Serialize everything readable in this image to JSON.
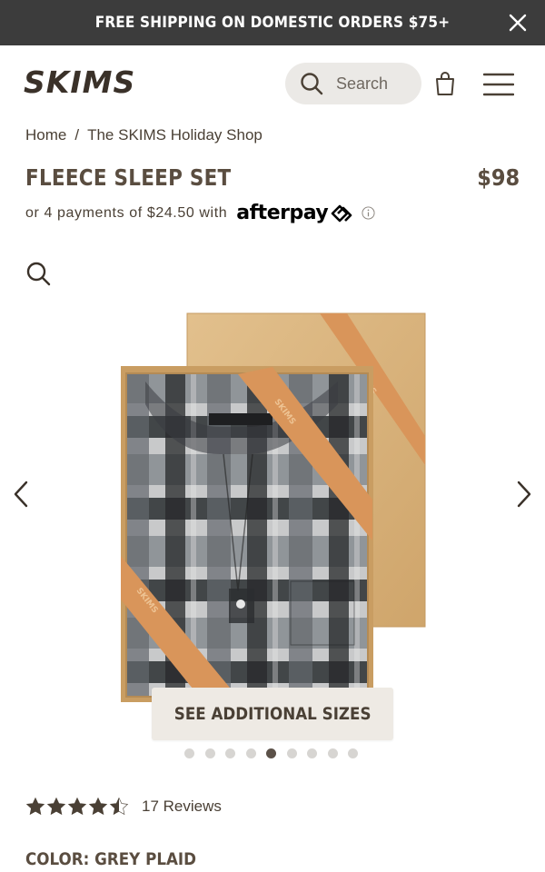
{
  "promo": {
    "text": "FREE SHIPPING ON DOMESTIC ORDERS $75+",
    "close_icon": "close-icon"
  },
  "header": {
    "logo_text": "SKIMS",
    "search_placeholder": "Search",
    "icons": [
      "search-icon",
      "shopping-bag-icon",
      "hamburger-menu-icon"
    ]
  },
  "breadcrumb": {
    "items": [
      "Home",
      "The SKIMS Holiday Shop"
    ],
    "separator": "/"
  },
  "product": {
    "title": "FLEECE SLEEP SET",
    "price": "$98",
    "installment_text": "or 4 payments of $24.50 with",
    "installment_provider": "afterpay",
    "sizes_button": "SEE ADDITIONAL SIZES",
    "rating": 4.5,
    "reviews_text": "17 Reviews",
    "color_label": "COLOR: GREY PLAID"
  },
  "gallery": {
    "total_images": 9,
    "active_index": 4,
    "ribbon_text": "SKIMS",
    "icons": [
      "zoom-icon",
      "chevron-left-icon",
      "chevron-right-icon"
    ]
  },
  "colors": {
    "promo_bg": "#3c3c3c",
    "text_brown": "#4a4035",
    "search_bg": "#ebe9e6",
    "button_bg": "#eeeae4",
    "box_kraft": "#d9b57e",
    "ribbon": "#d9955a",
    "dot_active": "#5b5148",
    "dot_inactive": "#d7d5d2"
  }
}
